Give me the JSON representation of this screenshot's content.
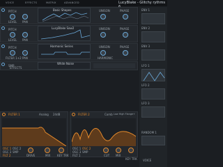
{
  "topbar": {
    "tabs": [
      "VOICE",
      "EFFECTS",
      "MATRIX",
      "ADVANCED"
    ],
    "preset_name": "LucyBlake - Glitchy rythms 6"
  },
  "oscillators": [
    {
      "label": "OSC 1",
      "pitch": "PITCH",
      "level": "LEVEL",
      "pan": "PAN",
      "wavetable": "Basic Shapes",
      "unison": "UNISON",
      "phase": "PHASE",
      "left_knob": "WAVE FRAME",
      "right_knob": "SPECTRAL MORPH"
    },
    {
      "label": "OSC 2",
      "pitch": "PITCH",
      "level": "LEVEL",
      "pan": "PAN",
      "wavetable": "LucyBlake Saw2",
      "unison": "UNISON",
      "phase": "PHASE",
      "left_knob": "WAVE FRAME",
      "right_knob": "FORMANT"
    },
    {
      "label": "OSC 3",
      "pitch": "PITCH",
      "level": "LEVEL",
      "pan": "PAN",
      "wavetable": "Harmonic Series",
      "unison": "UNISON",
      "phase": "PHASE",
      "left_knob": "FILTER 1+2",
      "right_knob": "HARMONIC"
    }
  ],
  "smp": {
    "label": "SMP",
    "name": "White Noise",
    "effects": "EFFECTS"
  },
  "filters": [
    {
      "title": "FILTER 1",
      "type": "Analog",
      "model": "24dB",
      "knobs": [
        "DRIVE",
        "MIX",
        "KEY TRK"
      ],
      "routing": [
        "OSC 1",
        "OSC 2",
        "OSC 3",
        "SMP",
        "FILT 2"
      ]
    },
    {
      "title": "FILTER 2",
      "type": "Comb",
      "model": "Low High Flange+",
      "knobs": [
        "CUT",
        "MIX",
        "KEY TRK"
      ],
      "routing": [
        "OSC 1",
        "OSC 2",
        "OSC 3",
        "SMP",
        "FILT 1"
      ]
    }
  ],
  "right_panel": {
    "env": [
      "ENV 1",
      "ENV 2",
      "ENV 3"
    ],
    "lfo": [
      "LFO 1",
      "LFO 2",
      "LFO 3"
    ],
    "random": "RANDOM 1",
    "voice": "VOICE"
  },
  "colors": {
    "accent_blue": "#6aa8d8",
    "accent_orange": "#e3892c",
    "panel": "#24282d"
  }
}
